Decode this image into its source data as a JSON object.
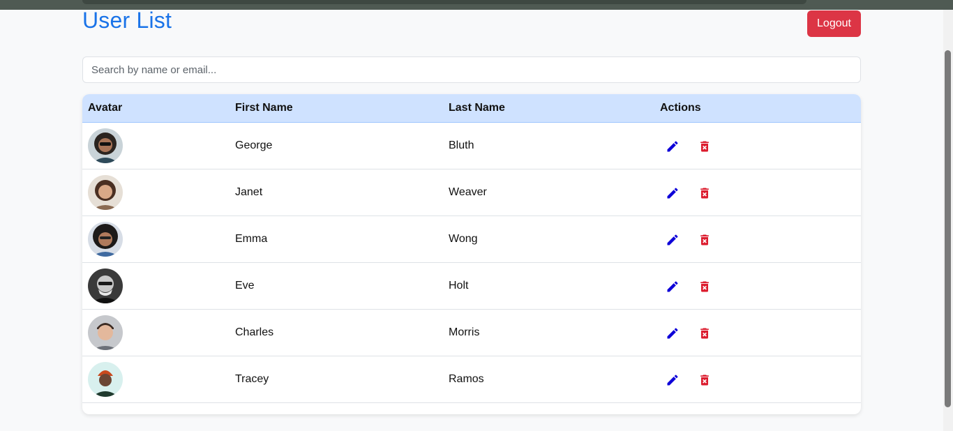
{
  "header": {
    "title": "User List",
    "logout_label": "Logout"
  },
  "search": {
    "placeholder": "Search by name or email...",
    "value": ""
  },
  "table": {
    "columns": [
      "Avatar",
      "First Name",
      "Last Name",
      "Actions"
    ],
    "rows": [
      {
        "first_name": "George",
        "last_name": "Bluth"
      },
      {
        "first_name": "Janet",
        "last_name": "Weaver"
      },
      {
        "first_name": "Emma",
        "last_name": "Wong"
      },
      {
        "first_name": "Eve",
        "last_name": "Holt"
      },
      {
        "first_name": "Charles",
        "last_name": "Morris"
      },
      {
        "first_name": "Tracey",
        "last_name": "Ramos"
      }
    ],
    "actions": [
      "edit-icon",
      "delete-icon"
    ]
  },
  "colors": {
    "title": "#1a73e8",
    "logout": "#dc3545",
    "header_bg": "#cfe2ff",
    "edit_icon": "#0d00d8",
    "delete_icon": "#dc1c2e"
  }
}
